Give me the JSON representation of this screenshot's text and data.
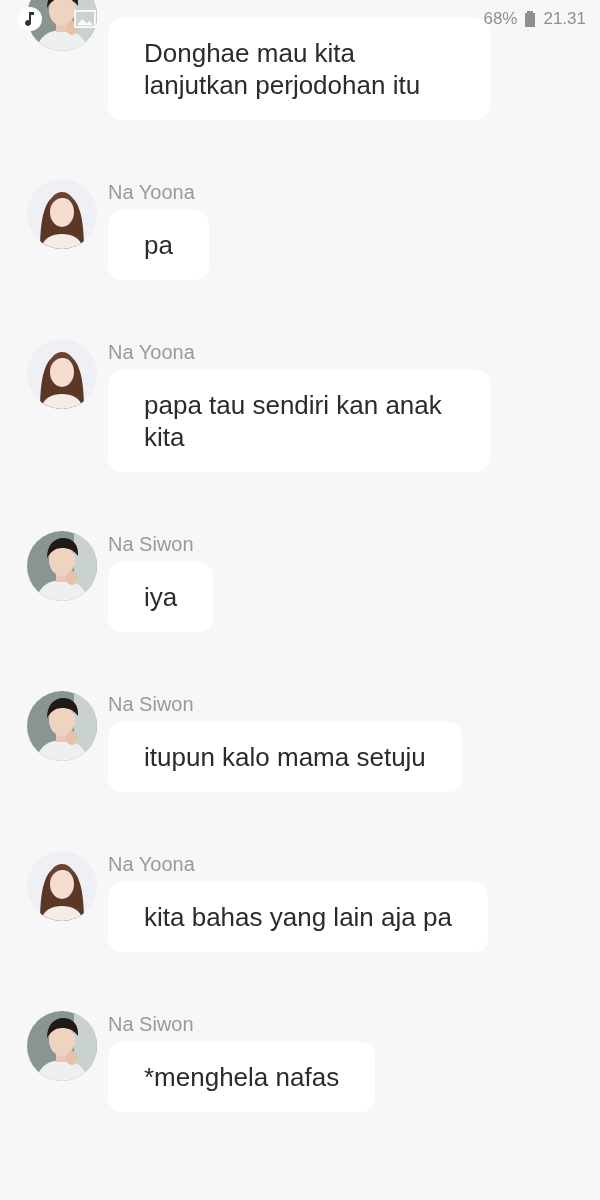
{
  "status_bar": {
    "battery": "68%",
    "time": "21.31"
  },
  "messages": [
    {
      "kind": "short-hair",
      "text": "Donghae mau kita lanjutkan perjodohan itu"
    },
    {
      "kind": "long-hair",
      "sender": "Na Yoona",
      "text": "pa"
    },
    {
      "kind": "long-hair",
      "sender": "Na Yoona",
      "text": "papa tau sendiri kan anak kita"
    },
    {
      "kind": "short-hair",
      "sender": "Na Siwon",
      "text": "iya"
    },
    {
      "kind": "short-hair",
      "sender": "Na Siwon",
      "text": "itupun kalo mama setuju"
    },
    {
      "kind": "long-hair",
      "sender": "Na Yoona",
      "text": "kita bahas yang lain aja pa"
    },
    {
      "kind": "short-hair",
      "sender": "Na Siwon",
      "text": "*menghela nafas"
    }
  ]
}
